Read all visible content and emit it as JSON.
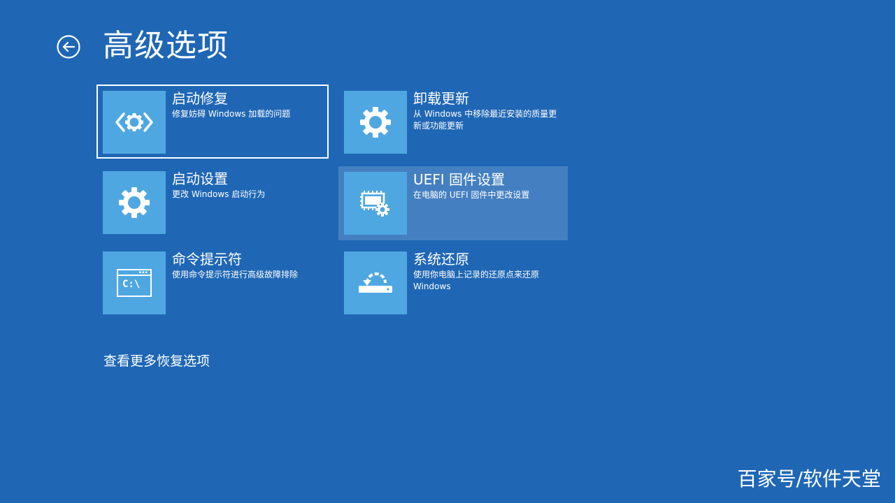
{
  "header": {
    "title": "高级选项",
    "back_icon": "back-arrow-circle-icon"
  },
  "options": [
    {
      "title": "启动修复",
      "description": "修复妨碍 Windows 加载的问题",
      "icon": "startup-repair-gear-icon",
      "state": "focused"
    },
    {
      "title": "卸载更新",
      "description": "从 Windows 中移除最近安装的质量更新或功能更新",
      "icon": "gear-icon",
      "state": "normal"
    },
    {
      "title": "启动设置",
      "description": "更改 Windows 启动行为",
      "icon": "gear-icon",
      "state": "normal"
    },
    {
      "title": "UEFI 固件设置",
      "description": "在电脑的 UEFI 固件中更改设置",
      "icon": "firmware-chip-gear-icon",
      "state": "hovered"
    },
    {
      "title": "命令提示符",
      "description": "使用命令提示符进行高级故障排除",
      "icon": "command-prompt-icon",
      "icon_text": "C:\\",
      "state": "normal"
    },
    {
      "title": "系统还原",
      "description": "使用你电脑上记录的还原点来还原 Windows",
      "icon": "system-restore-icon",
      "state": "normal"
    }
  ],
  "footer": {
    "more_options": "查看更多恢复选项"
  },
  "watermark": "百家号/软件天堂",
  "colors": {
    "background": "#1f67b5",
    "icon_tile": "#4fa7e1",
    "text": "#ffffff"
  }
}
